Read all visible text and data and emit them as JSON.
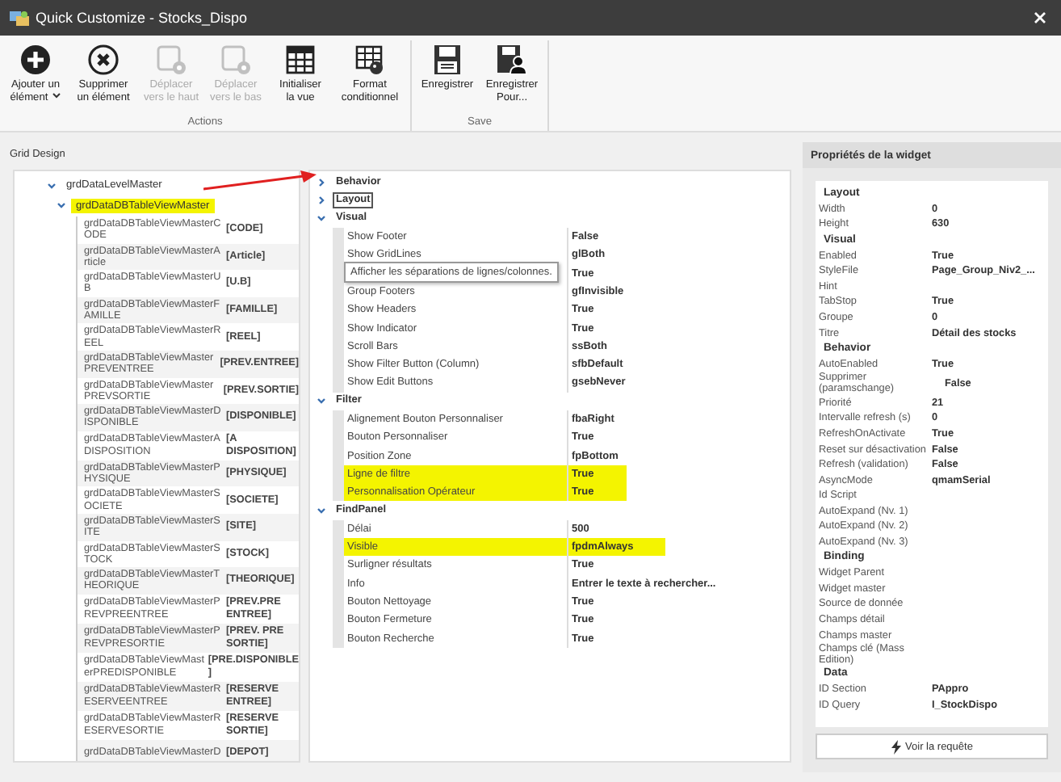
{
  "window": {
    "title": "Quick Customize - Stocks_Dispo"
  },
  "ribbon": {
    "groups": [
      {
        "label": "Actions",
        "buttons": [
          {
            "kind": "add",
            "lines": [
              "Ajouter un",
              "élément"
            ],
            "dropdown": true,
            "disabled": false
          },
          {
            "kind": "delete",
            "lines": [
              "Supprimer",
              "un élément"
            ],
            "dropdown": false,
            "disabled": false
          },
          {
            "kind": "move",
            "lines": [
              "Déplacer",
              "vers le haut"
            ],
            "dropdown": false,
            "disabled": true
          },
          {
            "kind": "move",
            "lines": [
              "Déplacer",
              "vers le bas"
            ],
            "dropdown": false,
            "disabled": true
          },
          {
            "kind": "grid",
            "lines": [
              "Initialiser",
              "la vue"
            ],
            "dropdown": false,
            "disabled": false
          },
          {
            "kind": "format",
            "lines": [
              "Format",
              "conditionnel"
            ],
            "dropdown": false,
            "disabled": false
          }
        ]
      },
      {
        "label": "Save",
        "buttons": [
          {
            "kind": "save",
            "lines": [
              "Enregistrer"
            ],
            "dropdown": false,
            "disabled": false
          },
          {
            "kind": "save_as",
            "lines": [
              "Enregistrer",
              "Pour..."
            ],
            "dropdown": false,
            "disabled": false
          }
        ]
      }
    ]
  },
  "grid_design": {
    "label": "Grid Design",
    "tree": {
      "label": "grdDataLevelMaster",
      "expanded": true,
      "children": [
        {
          "label": "grdDataDBTableViewMaster",
          "expanded": true,
          "selected": true,
          "children": [
            {
              "label": "grdDataDBTableViewMasterCODE",
              "caption": "[CODE]",
              "selected": false
            },
            {
              "label": "grdDataDBTableViewMasterArticle",
              "caption": "[Article]",
              "selected": false
            },
            {
              "label": "grdDataDBTableViewMasterUB",
              "caption": "[U.B]",
              "selected": false
            },
            {
              "label": "grdDataDBTableViewMasterFAMILLE",
              "caption": "[FAMILLE]",
              "selected": false
            },
            {
              "label": "grdDataDBTableViewMasterREEL",
              "caption": "[REEL]",
              "selected": false
            },
            {
              "label": "grdDataDBTableViewMasterPREVENTREE",
              "caption": "[PREV.ENTREE]",
              "selected": false
            },
            {
              "label": "grdDataDBTableViewMasterPREVSORTIE",
              "caption": "[PREV.SORTIE]",
              "selected": false
            },
            {
              "label": "grdDataDBTableViewMasterDISPONIBLE",
              "caption": "[DISPONIBLE]",
              "selected": false
            },
            {
              "label": "grdDataDBTableViewMasterADISPOSITION",
              "caption": "[A DISPOSITION]",
              "selected": false
            },
            {
              "label": "grdDataDBTableViewMasterPHYSIQUE",
              "caption": "[PHYSIQUE]",
              "selected": false
            },
            {
              "label": "grdDataDBTableViewMasterSOCIETE",
              "caption": "[SOCIETE]",
              "selected": false
            },
            {
              "label": "grdDataDBTableViewMasterSITE",
              "caption": "[SITE]",
              "selected": false
            },
            {
              "label": "grdDataDBTableViewMasterSTOCK",
              "caption": "[STOCK]",
              "selected": false
            },
            {
              "label": "grdDataDBTableViewMasterTHEORIQUE",
              "caption": "[THEORIQUE]",
              "selected": false
            },
            {
              "label": "grdDataDBTableViewMasterPREVPREENTREE",
              "caption": "[PREV.PRE ENTREE]",
              "selected": false
            },
            {
              "label": "grdDataDBTableViewMasterPREVPRESORTIE",
              "caption": "[PREV. PRE SORTIE]",
              "selected": false
            },
            {
              "label": "grdDataDBTableViewMasterPREDISPONIBLE",
              "caption": "[PRE.DISPONIBLE ]",
              "selected": false
            },
            {
              "label": "grdDataDBTableViewMasterRESERVEENTREE",
              "caption": "[RESERVE ENTREE]",
              "selected": false
            },
            {
              "label": "grdDataDBTableViewMasterRESERVESORTIE",
              "caption": "[RESERVE SORTIE]",
              "selected": false
            },
            {
              "label": "grdDataDBTableViewMasterD",
              "caption": "[DEPOT]",
              "selected": false
            }
          ]
        }
      ]
    },
    "properties": [
      {
        "label": "Behavior",
        "expanded": false,
        "focused": false
      },
      {
        "label": "Layout",
        "expanded": false,
        "focused": true
      },
      {
        "label": "Visual",
        "expanded": true,
        "focused": false,
        "rows": [
          {
            "name": "Show Footer",
            "value": "False",
            "highlighted": false
          },
          {
            "name": "Show GridLines",
            "value": "glBoth",
            "highlighted": false,
            "tooltip": "Afficher les séparations de lignes/colonnes."
          },
          {
            "value": "True",
            "highlighted": false
          },
          {
            "name": "Group Footers",
            "value": "gfInvisible",
            "highlighted": false
          },
          {
            "name": "Show Headers",
            "value": "True",
            "highlighted": false
          },
          {
            "name": "Show Indicator",
            "value": "True",
            "highlighted": false
          },
          {
            "name": "Scroll Bars",
            "value": "ssBoth",
            "highlighted": false
          },
          {
            "name": "Show Filter Button (Column)",
            "value": "sfbDefault",
            "highlighted": false
          },
          {
            "name": "Show Edit Buttons",
            "value": "gsebNever",
            "highlighted": false
          }
        ]
      },
      {
        "label": "Filter",
        "expanded": true,
        "focused": false,
        "rows": [
          {
            "name": "Alignement Bouton Personnaliser",
            "value": "fbaRight",
            "highlighted": false
          },
          {
            "name": "Bouton Personnaliser",
            "value": "True",
            "highlighted": false
          },
          {
            "name": "Position Zone",
            "value": "fpBottom",
            "highlighted": false
          },
          {
            "name": "Ligne de filtre",
            "value": "True",
            "highlighted": true
          },
          {
            "name": "Personnalisation Opérateur",
            "value": "True",
            "highlighted": true
          }
        ]
      },
      {
        "label": "FindPanel",
        "expanded": true,
        "focused": false,
        "rows": [
          {
            "name": "Délai",
            "value": "500",
            "highlighted": false
          },
          {
            "name": "Visible",
            "value": "fpdmAlways",
            "highlighted": true
          },
          {
            "name": "Surligner résultats",
            "value": "True",
            "highlighted": false
          },
          {
            "name": "Info",
            "value": "Entrer le texte à rechercher...",
            "highlighted": false
          },
          {
            "name": "Bouton Nettoyage",
            "value": "True",
            "highlighted": false
          },
          {
            "name": "Bouton Fermeture",
            "value": "True",
            "highlighted": false
          },
          {
            "name": "Bouton Recherche",
            "value": "True",
            "highlighted": false
          }
        ]
      }
    ]
  },
  "widget_properties": {
    "title": "Propriétés de la widget",
    "items": [
      {
        "kind": "section",
        "name": "Layout"
      },
      {
        "kind": "property",
        "name": "Width",
        "value": "0"
      },
      {
        "kind": "property",
        "name": "Height",
        "value": "630"
      },
      {
        "kind": "section",
        "name": "Visual"
      },
      {
        "kind": "property",
        "name": "Enabled",
        "value": "True"
      },
      {
        "kind": "property",
        "name": "StyleFile",
        "value": "Page_Group_Niv2_..."
      },
      {
        "kind": "property",
        "name": "Hint"
      },
      {
        "kind": "property",
        "name": "TabStop",
        "value": "True"
      },
      {
        "kind": "property",
        "name": "Groupe",
        "value": "0"
      },
      {
        "kind": "property",
        "name": "Titre",
        "value": "Détail des stocks"
      },
      {
        "kind": "section",
        "name": "Behavior"
      },
      {
        "kind": "property",
        "name": "AutoEnabled",
        "value": "True"
      },
      {
        "kind": "property",
        "name": "Supprimer (paramschange)",
        "value": "False"
      },
      {
        "kind": "property",
        "name": "Priorité",
        "value": "21"
      },
      {
        "kind": "property",
        "name": "Intervalle refresh (s)",
        "value": "0"
      },
      {
        "kind": "property",
        "name": "RefreshOnActivate",
        "value": "True"
      },
      {
        "kind": "property",
        "name": "Reset sur désactivation",
        "value": "False"
      },
      {
        "kind": "property",
        "name": "Refresh (validation)",
        "value": "False"
      },
      {
        "kind": "property",
        "name": "AsyncMode",
        "value": "qmamSerial"
      },
      {
        "kind": "property",
        "name": "Id Script"
      },
      {
        "kind": "property",
        "name": "AutoExpand (Nv. 1)"
      },
      {
        "kind": "property",
        "name": "AutoExpand (Nv. 2)"
      },
      {
        "kind": "property",
        "name": "AutoExpand (Nv. 3)"
      },
      {
        "kind": "section",
        "name": "Binding"
      },
      {
        "kind": "property",
        "name": "Widget Parent"
      },
      {
        "kind": "property",
        "name": "Widget master"
      },
      {
        "kind": "property",
        "name": "Source de donnée"
      },
      {
        "kind": "property",
        "name": "Champs détail"
      },
      {
        "kind": "property",
        "name": "Champs master"
      },
      {
        "kind": "property",
        "name": "Champs clé (Mass Edition)"
      },
      {
        "kind": "section",
        "name": "Data"
      },
      {
        "kind": "property",
        "name": "ID Section",
        "value": "PAppro"
      },
      {
        "kind": "property",
        "name": "ID Query",
        "value": "I_StockDispo"
      }
    ],
    "button": "Voir la requête"
  }
}
